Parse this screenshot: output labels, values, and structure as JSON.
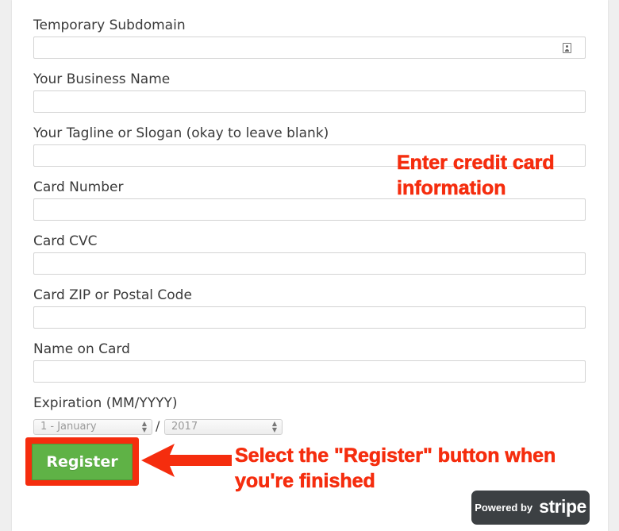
{
  "form": {
    "subdomain": {
      "label": "Temporary Subdomain",
      "value": "",
      "placeholder": ""
    },
    "business_name": {
      "label": "Your Business Name",
      "value": "",
      "placeholder": ""
    },
    "tagline": {
      "label": "Your Tagline or Slogan (okay to leave blank)",
      "value": "",
      "placeholder": ""
    },
    "card_number": {
      "label": "Card Number",
      "value": "",
      "placeholder": ""
    },
    "card_cvc": {
      "label": "Card CVC",
      "value": "",
      "placeholder": ""
    },
    "card_zip": {
      "label": "Card ZIP or Postal Code",
      "value": "",
      "placeholder": ""
    },
    "name_on_card": {
      "label": "Name on Card",
      "value": "",
      "placeholder": ""
    },
    "expiration": {
      "label": "Expiration (MM/YYYY)",
      "month_selected": "1 - January",
      "separator": "/",
      "year_selected": "2017"
    },
    "register_label": "Register"
  },
  "annotations": {
    "card_info_line1": "Enter credit card",
    "card_info_line2": "information",
    "register_line1": "Select the \"Register\" button when",
    "register_line2": "you're finished"
  },
  "badge": {
    "powered_by": "Powered by",
    "brand": "stripe"
  },
  "colors": {
    "annotation": "#f52d0e",
    "register_button": "#5fb246",
    "badge_background": "#3c4043"
  },
  "icons": {
    "subdomain_field": "contact-card-icon",
    "annotation_arrow": "left-arrow-icon",
    "select_arrows": "up-down-chevron-icon"
  }
}
